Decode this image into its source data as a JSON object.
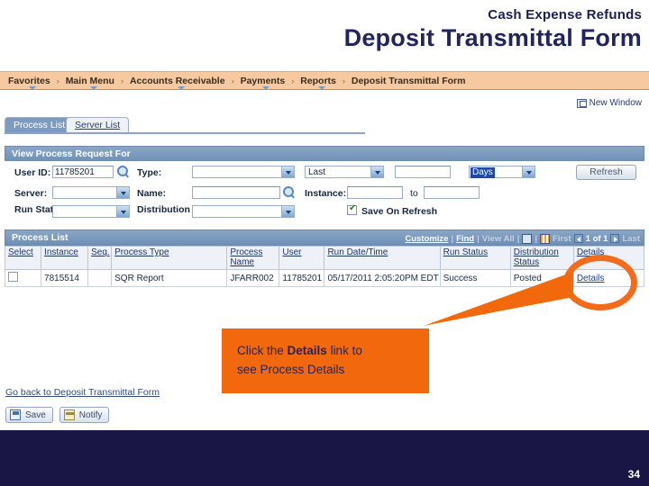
{
  "slide": {
    "subtitle": "Cash Expense Refunds",
    "title": "Deposit Transmittal Form",
    "page_number": "34",
    "accent_orange": "#f2690d",
    "navy": "#191544",
    "title_color": "#23245e"
  },
  "nav": {
    "items": [
      {
        "label": "Favorites",
        "has_caret": true
      },
      {
        "label": "Main Menu",
        "has_caret": true
      },
      {
        "label": "Accounts Receivable",
        "has_caret": true
      },
      {
        "label": "Payments",
        "has_caret": true
      },
      {
        "label": "Reports",
        "has_caret": true
      },
      {
        "label": "Deposit Transmittal Form",
        "has_caret": false
      }
    ],
    "separator": "›"
  },
  "toolbar": {
    "new_window": "New Window"
  },
  "tabs": [
    {
      "label": "Process List",
      "active": true
    },
    {
      "label": "Server List",
      "active": false
    }
  ],
  "section": {
    "header": "View Process Request For"
  },
  "filter": {
    "user_id_label": "User ID:",
    "user_id_value": "11785201",
    "type_label": "Type:",
    "type_value": "",
    "last_value": "Last",
    "count_value": "",
    "unit_value": "Days",
    "refresh_label": "Refresh",
    "server_label": "Server:",
    "server_value": "",
    "name_label": "Name:",
    "name_value": "",
    "instance_label": "Instance:",
    "instance_from": "",
    "instance_to_label": "to",
    "instance_to": "",
    "run_status_label": "Run Status:",
    "run_status_value": "",
    "dist_status_label": "Distribution Status:",
    "dist_status_value": "",
    "save_on_refresh_label": "Save On Refresh",
    "save_on_refresh_checked": true
  },
  "grid": {
    "title": "Process List",
    "tools": {
      "customize": "Customize",
      "find": "Find",
      "view_all": "View All",
      "sep": "|",
      "first": "First",
      "page_indicator": "1 of 1",
      "last": "Last"
    },
    "columns": [
      "Select",
      "Instance",
      "Seq.",
      "Process Type",
      "Process Name",
      "User",
      "Run Date/Time",
      "Run Status",
      "Distribution Status",
      "Details"
    ],
    "rows": [
      {
        "select": "",
        "instance": "7815514",
        "seq": "",
        "process_type": "SQR Report",
        "process_name": "JFARR002",
        "user": "11785201",
        "run_datetime": "05/17/2011  2:05:20PM EDT",
        "run_status": "Success",
        "distribution_status": "Posted",
        "details": "Details"
      }
    ]
  },
  "callout": {
    "line1_pre": "Click the ",
    "line1_bold": "Details",
    "line1_post": " link to",
    "line2": "see Process Details"
  },
  "bottom": {
    "back_link": "Go back to Deposit Transmittal Form",
    "save_label": "Save",
    "notify_label": "Notify"
  }
}
